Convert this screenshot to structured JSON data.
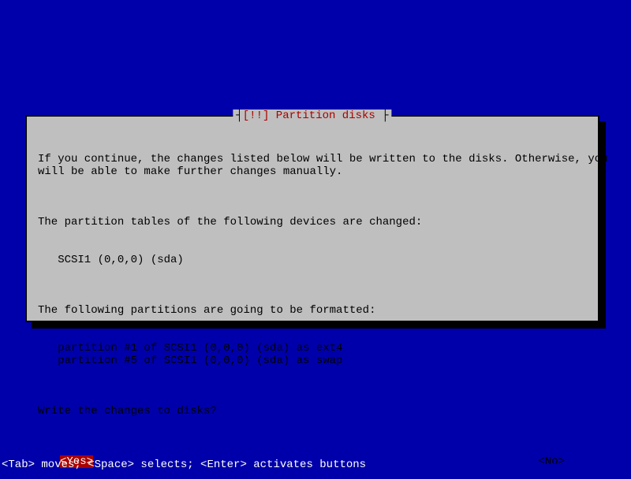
{
  "dialog": {
    "title_prefix": "┤",
    "title_marker": "[!!]",
    "title_text": " Partition disks ",
    "title_suffix": "├",
    "intro": "If you continue, the changes listed below will be written to the disks. Otherwise, you\nwill be able to make further changes manually.",
    "tables_header": "The partition tables of the following devices are changed:",
    "tables_items": "   SCSI1 (0,0,0) (sda)",
    "format_header": "The following partitions are going to be formatted:",
    "format_items": "   partition #1 of SCSI1 (0,0,0) (sda) as ext4\n   partition #5 of SCSI1 (0,0,0) (sda) as swap",
    "prompt": "Write the changes to disks?",
    "yes_label": "<Yes>",
    "no_label": "<No>"
  },
  "footer": "<Tab> moves; <Space> selects; <Enter> activates buttons"
}
